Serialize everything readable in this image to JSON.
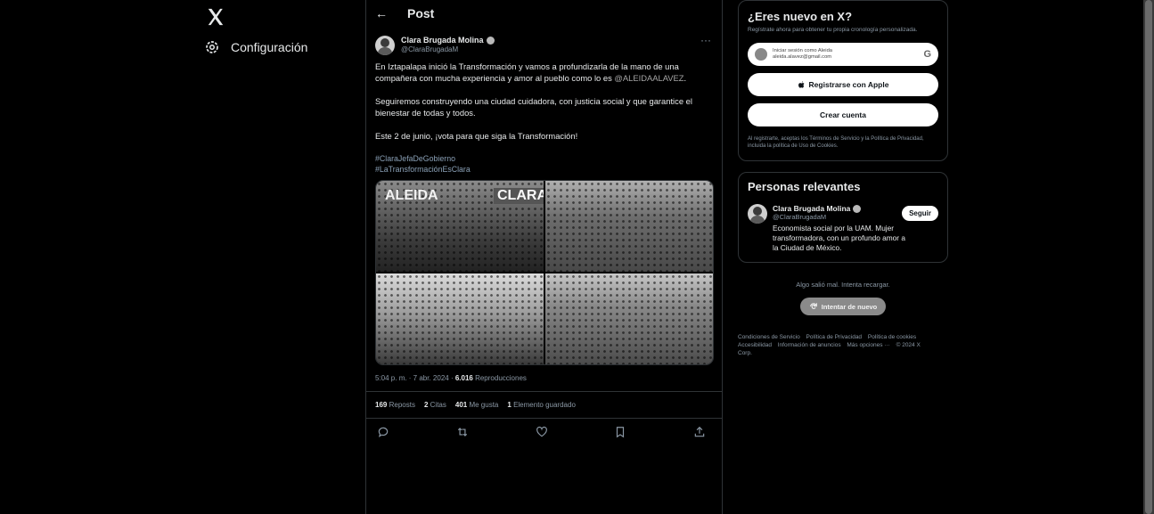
{
  "nav": {
    "logo_icon": "x-logo-icon",
    "settings_icon": "gear-icon",
    "settings_label": "Configuración"
  },
  "header": {
    "back_icon": "arrow-left-icon",
    "back_glyph": "←",
    "title": "Post"
  },
  "post": {
    "author_name": "Clara Brugada Molina",
    "author_handle": "@ClaraBrugadaM",
    "more_glyph": "···",
    "paragraph1": "En Iztapalapa inició la Transformación y vamos a profundizarla de la mano de una compañera con mucha experiencia y amor al pueblo como lo es",
    "mention": "@ALEIDAALAVEZ",
    "paragraph1_end": ".",
    "paragraph2": "Seguiremos construyendo una ciudad cuidadora, con justicia social y que garantice el bienestar de todas y todos.",
    "paragraph3": "Este 2 de junio, ¡vota para que siga la Transformación!",
    "hashtags": [
      "#ClaraJefaDeGobierno",
      "#LaTransformaciónEsClara"
    ],
    "banner_left": "ALEIDA",
    "banner_right": "CLARA",
    "meta_time": "5:04 p. m. · 7 abr. 2024 · ",
    "meta_views_num": "6.016",
    "meta_views_label": " Reproducciones",
    "stats": {
      "reposts_num": "169",
      "reposts_label": "Reposts",
      "quotes_num": "2",
      "quotes_label": "Citas",
      "likes_num": "401",
      "likes_label": "Me gusta",
      "bookmarks_num": "1",
      "bookmarks_label": "Elemento guardado"
    },
    "action_icons": [
      "reply-icon",
      "repost-icon",
      "like-icon",
      "bookmark-icon",
      "share-icon"
    ]
  },
  "signup": {
    "title": "¿Eres nuevo en X?",
    "description": "Regístrate ahora para obtener tu propia cronología personalizada.",
    "google_line1": "Iniciar sesión como Aleida",
    "google_line2": "aleida.alavez@gmail.com",
    "google_icon": "google-g-icon",
    "apple_icon": "apple-icon",
    "apple_label": "Registrarse con Apple",
    "create_label": "Crear cuenta",
    "terms": "Al registrarte, aceptas los Términos de Servicio y la Política de Privacidad, incluida la política de Uso de Cookies."
  },
  "relevant": {
    "title": "Personas relevantes",
    "name": "Clara Brugada Molina",
    "handle": "@ClaraBrugadaM",
    "bio": "Economista social por la UAM. Mujer transformadora, con un profundo amor a la Ciudad de México.",
    "follow_label": "Seguir"
  },
  "error": {
    "text": "Algo salió mal. Intenta recargar.",
    "retry_icon": "refresh-icon",
    "retry_label": "Intentar de nuevo"
  },
  "footer": {
    "links": [
      "Condiciones de Servicio",
      "Política de Privacidad",
      "Política de cookies",
      "Accesibilidad",
      "Información de anuncios",
      "Más opciones ···",
      "© 2024 X Corp."
    ]
  }
}
